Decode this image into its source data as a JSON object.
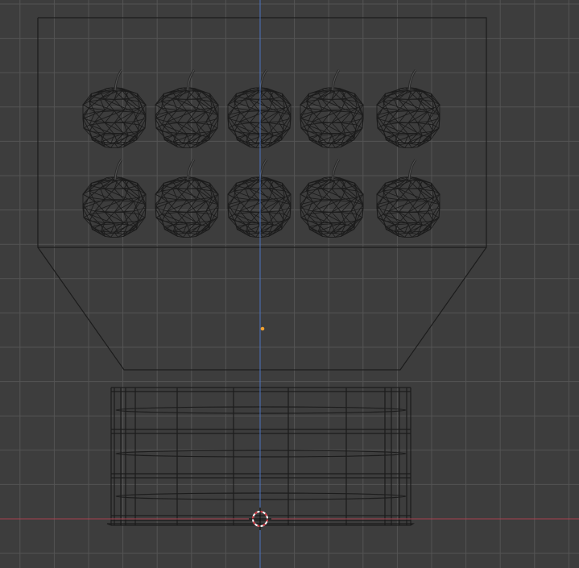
{
  "viewport": {
    "mode": "wireframe",
    "colors": {
      "background": "#3d3d3d",
      "grid": "#545454",
      "x_axis": "#a8414f",
      "z_axis": "#4a72c0",
      "wire": "#1c1c1c",
      "origin_dot": "#f0a030",
      "cursor_red": "#c8323c",
      "cursor_white": "#ffffff"
    },
    "apples": {
      "rows": 2,
      "columns": 5
    }
  }
}
